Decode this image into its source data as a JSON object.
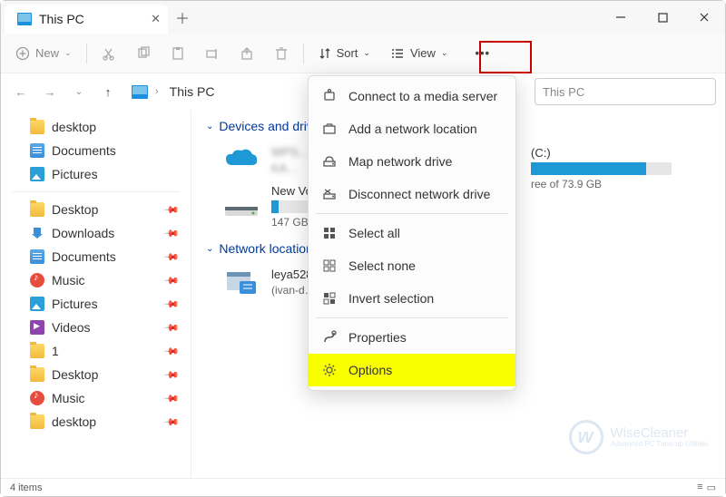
{
  "titlebar": {
    "tab_title": "This PC"
  },
  "toolbar": {
    "new_label": "New",
    "sort_label": "Sort",
    "view_label": "View"
  },
  "nav": {
    "crumb": "This PC",
    "search_placeholder": "This PC"
  },
  "sidebar": {
    "quick": [
      {
        "icon": "folder",
        "label": "desktop"
      },
      {
        "icon": "doc",
        "label": "Documents"
      },
      {
        "icon": "pic",
        "label": "Pictures"
      }
    ],
    "pinned": [
      {
        "icon": "folder",
        "label": "Desktop"
      },
      {
        "icon": "down",
        "label": "Downloads"
      },
      {
        "icon": "doc",
        "label": "Documents"
      },
      {
        "icon": "music",
        "label": "Music"
      },
      {
        "icon": "pic",
        "label": "Pictures"
      },
      {
        "icon": "video",
        "label": "Videos"
      },
      {
        "icon": "folder",
        "label": "1"
      },
      {
        "icon": "folder",
        "label": "Desktop"
      },
      {
        "icon": "music",
        "label": "Music"
      },
      {
        "icon": "folder",
        "label": "desktop"
      }
    ]
  },
  "main": {
    "sections": {
      "devices": {
        "header": "Devices and drives",
        "drives": [
          {
            "name_blur": true,
            "line1": "WPS…",
            "line2": "KA…"
          },
          {
            "name": "(C:)",
            "free": "ree of 73.9 GB",
            "fill_pct": 82
          },
          {
            "name": "New Vo",
            "free": "147 GB…",
            "fill_pct": 16
          }
        ]
      },
      "network": {
        "header": "Network locations",
        "items": [
          {
            "line1": "leya528…",
            "line2": "(ivan-d…"
          }
        ]
      }
    }
  },
  "menu": {
    "items": [
      {
        "id": "connect-media",
        "label": "Connect to a media server"
      },
      {
        "id": "add-netloc",
        "label": "Add a network location"
      },
      {
        "id": "map-drive",
        "label": "Map network drive"
      },
      {
        "id": "disconnect-drive",
        "label": "Disconnect network drive"
      },
      {
        "sep": true
      },
      {
        "id": "select-all",
        "label": "Select all"
      },
      {
        "id": "select-none",
        "label": "Select none"
      },
      {
        "id": "invert-sel",
        "label": "Invert selection"
      },
      {
        "sep": true
      },
      {
        "id": "properties",
        "label": "Properties"
      },
      {
        "id": "options",
        "label": "Options",
        "hl": true
      }
    ]
  },
  "status": {
    "text": "4 items"
  },
  "watermark": {
    "title": "WiseCleaner",
    "sub": "Advanced PC Tune-up Utilities"
  }
}
